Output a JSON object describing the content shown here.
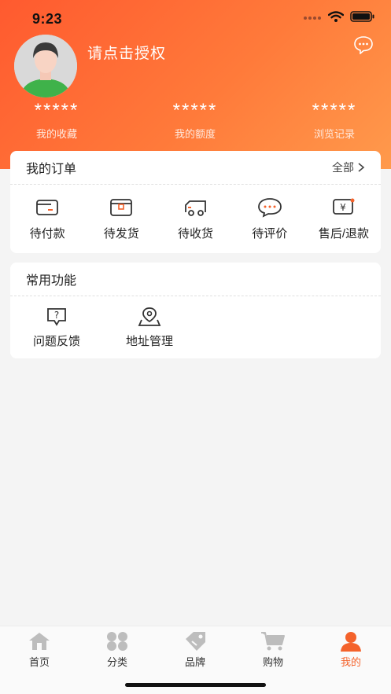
{
  "status_bar": {
    "time": "9:23"
  },
  "profile": {
    "auth_prompt": "请点击授权"
  },
  "stats": [
    {
      "value": "*****",
      "label": "我的收藏"
    },
    {
      "value": "*****",
      "label": "我的额度"
    },
    {
      "value": "*****",
      "label": "浏览记录"
    }
  ],
  "orders": {
    "title": "我的订单",
    "more_label": "全部",
    "items": [
      {
        "label": "待付款",
        "icon": "wallet-icon"
      },
      {
        "label": "待发货",
        "icon": "package-icon"
      },
      {
        "label": "待收货",
        "icon": "truck-icon"
      },
      {
        "label": "待评价",
        "icon": "comment-icon"
      },
      {
        "label": "售后/退款",
        "icon": "refund-icon"
      }
    ]
  },
  "functions": {
    "title": "常用功能",
    "items": [
      {
        "label": "问题反馈",
        "icon": "question-icon"
      },
      {
        "label": "地址管理",
        "icon": "location-icon"
      }
    ]
  },
  "tabbar": {
    "items": [
      {
        "label": "首页",
        "icon": "home-icon"
      },
      {
        "label": "分类",
        "icon": "category-icon"
      },
      {
        "label": "品牌",
        "icon": "tag-icon"
      },
      {
        "label": "购物",
        "icon": "cart-icon"
      },
      {
        "label": "我的",
        "icon": "user-icon"
      }
    ],
    "active": "我的"
  },
  "colors": {
    "accent": "#f4622b",
    "header_start": "#ff5a2f",
    "header_end": "#ff9a4c"
  }
}
